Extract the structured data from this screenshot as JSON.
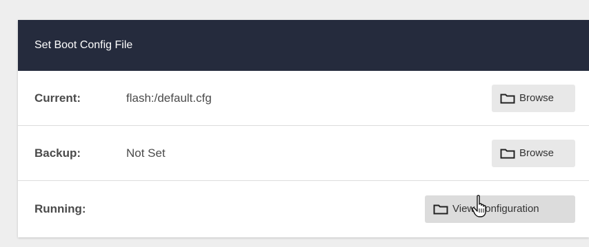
{
  "panel": {
    "title": "Set Boot Config File",
    "rows": [
      {
        "label": "Current:",
        "value": "flash:/default.cfg",
        "button": "Browse",
        "button_icon": "folder-icon"
      },
      {
        "label": "Backup:",
        "value": "Not Set",
        "button": "Browse",
        "button_icon": "folder-icon"
      },
      {
        "label": "Running:",
        "value": "",
        "button": "View Configuration",
        "button_icon": "folder-icon"
      }
    ]
  },
  "colors": {
    "header_bg": "#252b3d",
    "button_bg": "#e8e8e8",
    "text": "#4a4a4a"
  },
  "cursor": "hand-pointer-icon"
}
